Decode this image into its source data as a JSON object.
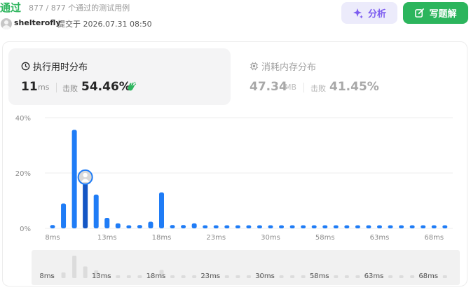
{
  "header": {
    "status": "通过",
    "test_count": "877 / 877 个通过的测试用例",
    "author": "shelterofly",
    "submitted": "提交于 2026.07.31 08:50"
  },
  "actions": {
    "analyze_label": "分析",
    "analyze_icon": "sparkle-icon",
    "solution_label": "写题解",
    "solution_icon": "edit-icon",
    "analyze_color": "#7c5cf0",
    "solution_color": "#2cb55d"
  },
  "runtime": {
    "title": "执行用时分布",
    "icon": "clock-icon",
    "value": "11",
    "unit": "ms",
    "beats_label": "击败",
    "beats": "54.46%",
    "badge_icon": "clapping-hands-icon"
  },
  "memory": {
    "title": "消耗内存分布",
    "icon": "chip-icon",
    "value": "47.34",
    "unit": "MB",
    "beats_label": "击败",
    "beats": "41.45%"
  },
  "chart_data": {
    "type": "bar",
    "y_tick_labels": [
      "40%",
      "20%",
      "0%"
    ],
    "ylim": [
      0,
      40
    ],
    "x_tick_labels": [
      "8ms",
      "13ms",
      "18ms",
      "23ms",
      "30ms",
      "58ms",
      "63ms",
      "68ms"
    ],
    "values": [
      1.2,
      9.0,
      35.6,
      18.5,
      12.2,
      3.8,
      1.8,
      1.1,
      1.2,
      2.4,
      13.0,
      1.2,
      1.2,
      1.8,
      1.1,
      1.1,
      1.1,
      1.1,
      1.1,
      1.1,
      1.1,
      1.1,
      1.1,
      1.1,
      1.1,
      1.1,
      1.1,
      1.1,
      1.1,
      1.1,
      1.1,
      1.1,
      1.1,
      1.1,
      1.1,
      1.1,
      1.1
    ],
    "highlight_index": 3,
    "bar_color": "#1f7cf6",
    "highlight_color": "#1456c4",
    "grid": true
  }
}
